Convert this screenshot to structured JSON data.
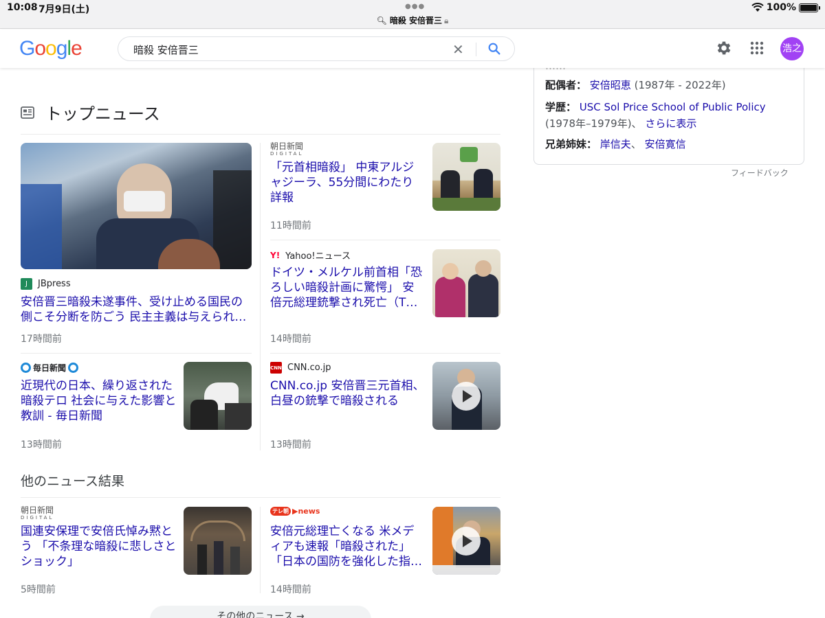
{
  "status_bar": {
    "time": "10:08",
    "date": "7月9日(土)",
    "url": "暗殺 安倍晋三",
    "battery": "100%"
  },
  "header": {
    "logo_letters": [
      {
        "ch": "G",
        "color": "#4285f4"
      },
      {
        "ch": "o",
        "color": "#ea4335"
      },
      {
        "ch": "o",
        "color": "#fbbc05"
      },
      {
        "ch": "g",
        "color": "#4285f4"
      },
      {
        "ch": "l",
        "color": "#34a853"
      },
      {
        "ch": "e",
        "color": "#ea4335"
      }
    ],
    "query": "暗殺 安倍晋三",
    "avatar_label": "浩之",
    "avatar_color": "#a142f4"
  },
  "top_news": {
    "title": "トップニュース",
    "icon": "newspaper-icon"
  },
  "articles": {
    "a1": {
      "source": "JBpress",
      "headline": "安倍晋三暗殺未遂事件、受け止める国民の側こそ分断を防ごう 民主主義は与えられ…",
      "time": "17時間前"
    },
    "a2": {
      "source": "朝日新聞 DIGITAL",
      "headline": "「元首相暗殺」 中東アルジャジーラ、55分間にわたり詳報",
      "time": "11時間前"
    },
    "a3": {
      "source": "Yahoo!ニュース",
      "headline": "ドイツ・メルケル前首相「恐ろしい暗殺計画に驚愕」 安倍元総理銃撃され死亡（T…",
      "time": "14時間前"
    },
    "a4": {
      "source": "毎日新聞",
      "headline": "近現代の日本、繰り返された暗殺テロ 社会に与えた影響と教訓 - 毎日新聞",
      "time": "13時間前"
    },
    "a5": {
      "source": "CNN.co.jp",
      "headline": "CNN.co.jp 安倍晋三元首相、白昼の銃撃で暗殺される",
      "time": "13時間前"
    }
  },
  "more_news": {
    "title": "他のニュース結果",
    "b1": {
      "source": "朝日新聞 DIGITAL",
      "headline": "国連安保理で安倍氏悼み黙とう 「不条理な暗殺に悲しさとショック」",
      "time": "5時間前"
    },
    "b2": {
      "source": "テレ朝news",
      "headline": "安倍元総理亡くなる 米メディアも速報「暗殺された」「日本の国防を強化した指…",
      "time": "14時間前"
    },
    "button_label": "その他のニュース →"
  },
  "knowledge_panel": {
    "spouse_label": "配偶者：",
    "spouse_value": "安倍昭恵",
    "spouse_years": "(1987年 - 2022年)",
    "education_label": "学歴：",
    "education_value": "USC Sol Price School of Public Policy",
    "education_years": "(1978年–1979年)、",
    "education_more": "さらに表示",
    "siblings_label": "兄弟姉妹：",
    "sibling_1": "岸信夫",
    "sibling_sep": "、",
    "sibling_2": "安倍寛信",
    "feedback": "フィードバック"
  }
}
